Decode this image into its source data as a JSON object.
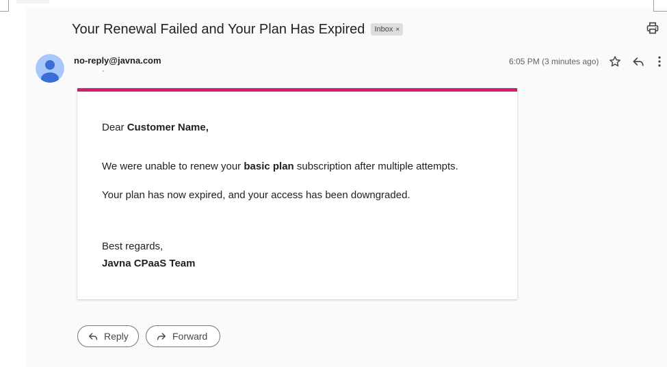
{
  "email": {
    "subject": "Your Renewal Failed and Your Plan Has Expired",
    "label": "Inbox",
    "label_remove": "×",
    "sender": "no-reply@javna.com",
    "timestamp": "6:05 PM (3 minutes ago)"
  },
  "message": {
    "greeting_prefix": "Dear ",
    "greeting_name": "Customer Name,",
    "line1_prefix": "We were unable to renew your ",
    "line1_bold": "basic plan",
    "line1_suffix": " subscription after multiple attempts.",
    "line2": "Your plan has now expired, and your access has been downgraded.",
    "closing": "Best regards,",
    "signature": "Javna CPaaS Team"
  },
  "actions": {
    "reply_label": "Reply",
    "forward_label": "Forward"
  },
  "icons": {
    "print": "print-icon",
    "star": "star-icon",
    "reply": "reply-icon",
    "more": "more-vert-icon",
    "avatar": "person-icon",
    "forward": "forward-icon"
  },
  "colors": {
    "accent_bar": "#d61a78",
    "avatar_bg": "#a8c7fa",
    "avatar_fg": "#3c6dd6"
  }
}
